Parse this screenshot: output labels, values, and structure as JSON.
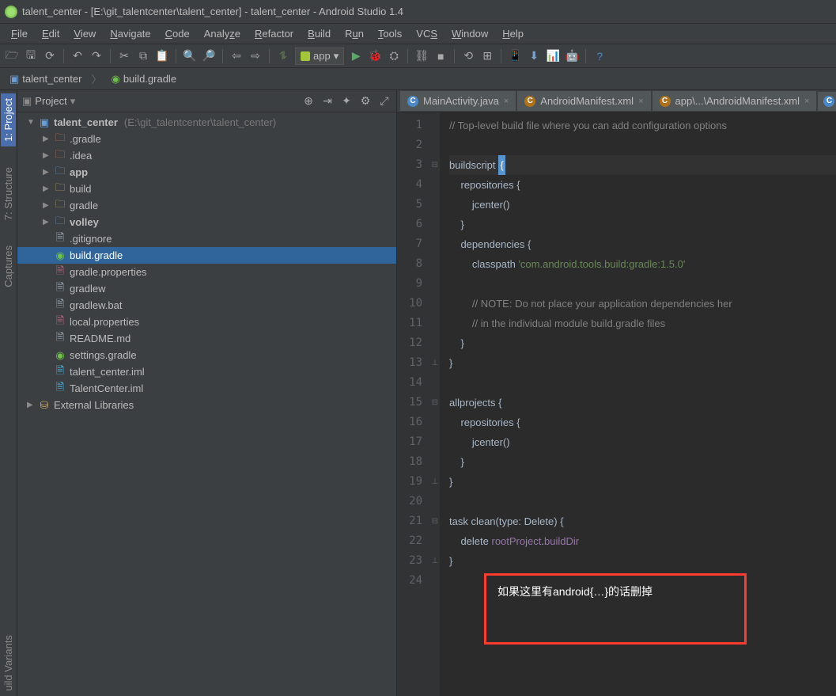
{
  "window": {
    "title": "talent_center - [E:\\git_talentcenter\\talent_center] - talent_center - Android Studio 1.4"
  },
  "menu": {
    "file": "File",
    "edit": "Edit",
    "view": "View",
    "navigate": "Navigate",
    "code": "Code",
    "analyze": "Analyze",
    "refactor": "Refactor",
    "build": "Build",
    "run": "Run",
    "tools": "Tools",
    "vcs": "VCS",
    "window": "Window",
    "help": "Help"
  },
  "run_config": {
    "label": "app",
    "dropdown": "▾"
  },
  "breadcrumb": {
    "project": "talent_center",
    "file": "build.gradle"
  },
  "panel": {
    "title": "Project",
    "dropdown": "▾"
  },
  "side_tabs": {
    "project": "1: Project",
    "structure": "7: Structure",
    "captures": "Captures",
    "build_variants": "uild Variants"
  },
  "tree": {
    "root": {
      "label": "talent_center",
      "hint": "(E:\\git_talentcenter\\talent_center)"
    },
    "items": [
      {
        "label": ".gradle",
        "icon": "folder-red",
        "arrow": "▶",
        "indent": 1
      },
      {
        "label": ".idea",
        "icon": "folder-red",
        "arrow": "▶",
        "indent": 1
      },
      {
        "label": "app",
        "icon": "folder-blue",
        "arrow": "▶",
        "indent": 1,
        "bold": true
      },
      {
        "label": "build",
        "icon": "folder",
        "arrow": "▶",
        "indent": 1
      },
      {
        "label": "gradle",
        "icon": "folder",
        "arrow": "▶",
        "indent": 1
      },
      {
        "label": "volley",
        "icon": "folder-blue",
        "arrow": "▶",
        "indent": 1,
        "bold": true
      },
      {
        "label": ".gitignore",
        "icon": "file",
        "arrow": "",
        "indent": 1
      },
      {
        "label": "build.gradle",
        "icon": "gradle",
        "arrow": "",
        "indent": 1,
        "selected": true
      },
      {
        "label": "gradle.properties",
        "icon": "prop",
        "arrow": "",
        "indent": 1
      },
      {
        "label": "gradlew",
        "icon": "file",
        "arrow": "",
        "indent": 1
      },
      {
        "label": "gradlew.bat",
        "icon": "file",
        "arrow": "",
        "indent": 1
      },
      {
        "label": "local.properties",
        "icon": "prop",
        "arrow": "",
        "indent": 1
      },
      {
        "label": "README.md",
        "icon": "file",
        "arrow": "",
        "indent": 1
      },
      {
        "label": "settings.gradle",
        "icon": "gradle",
        "arrow": "",
        "indent": 1
      },
      {
        "label": "talent_center.iml",
        "icon": "iml",
        "arrow": "",
        "indent": 1
      },
      {
        "label": "TalentCenter.iml",
        "icon": "iml",
        "arrow": "",
        "indent": 1
      }
    ],
    "ext_lib": {
      "label": "External Libraries",
      "arrow": "▶"
    }
  },
  "editor_tabs": [
    {
      "label": "MainActivity.java",
      "icon": "java"
    },
    {
      "label": "AndroidManifest.xml",
      "icon": "xml"
    },
    {
      "label": "app\\...\\AndroidManifest.xml",
      "icon": "xml"
    }
  ],
  "code": {
    "lines": [
      {
        "n": 1,
        "frags": [
          {
            "t": "// Top-level build file where you can add configuration options",
            "cls": "cmt"
          }
        ]
      },
      {
        "n": 2,
        "frags": []
      },
      {
        "n": 3,
        "caret": true,
        "frags": [
          {
            "t": "buildscript ",
            "cls": ""
          },
          {
            "t": "{",
            "caretHere": true
          }
        ]
      },
      {
        "n": 4,
        "frags": [
          {
            "t": "    repositories ",
            "cls": ""
          },
          {
            "t": "{",
            "cls": ""
          }
        ]
      },
      {
        "n": 5,
        "frags": [
          {
            "t": "        jcenter()",
            "cls": ""
          }
        ]
      },
      {
        "n": 6,
        "frags": [
          {
            "t": "    }",
            "cls": ""
          }
        ]
      },
      {
        "n": 7,
        "frags": [
          {
            "t": "    dependencies ",
            "cls": ""
          },
          {
            "t": "{",
            "cls": ""
          }
        ]
      },
      {
        "n": 8,
        "frags": [
          {
            "t": "        classpath ",
            "cls": ""
          },
          {
            "t": "'com.android.tools.build:gradle:1.5.0'",
            "cls": "str"
          }
        ]
      },
      {
        "n": 9,
        "frags": []
      },
      {
        "n": 10,
        "frags": [
          {
            "t": "        // NOTE: Do not place your application dependencies her",
            "cls": "cmt"
          }
        ]
      },
      {
        "n": 11,
        "frags": [
          {
            "t": "        // in the individual module build.gradle files",
            "cls": "cmt"
          }
        ]
      },
      {
        "n": 12,
        "frags": [
          {
            "t": "    }",
            "cls": ""
          }
        ]
      },
      {
        "n": 13,
        "frags": [
          {
            "t": "}",
            "cls": ""
          }
        ]
      },
      {
        "n": 14,
        "frags": []
      },
      {
        "n": 15,
        "frags": [
          {
            "t": "allprojects ",
            "cls": ""
          },
          {
            "t": "{",
            "cls": ""
          }
        ]
      },
      {
        "n": 16,
        "frags": [
          {
            "t": "    repositories ",
            "cls": ""
          },
          {
            "t": "{",
            "cls": ""
          }
        ]
      },
      {
        "n": 17,
        "frags": [
          {
            "t": "        jcenter()",
            "cls": ""
          }
        ]
      },
      {
        "n": 18,
        "frags": [
          {
            "t": "    }",
            "cls": ""
          }
        ]
      },
      {
        "n": 19,
        "frags": [
          {
            "t": "}",
            "cls": ""
          }
        ]
      },
      {
        "n": 20,
        "frags": []
      },
      {
        "n": 21,
        "frags": [
          {
            "t": "task clean(type: Delete) ",
            "cls": ""
          },
          {
            "t": "{",
            "cls": ""
          }
        ]
      },
      {
        "n": 22,
        "frags": [
          {
            "t": "    delete ",
            "cls": ""
          },
          {
            "t": "rootProject",
            "cls": "prop"
          },
          {
            "t": ".",
            "cls": ""
          },
          {
            "t": "buildDir",
            "cls": "prop"
          }
        ]
      },
      {
        "n": 23,
        "frags": [
          {
            "t": "}",
            "cls": ""
          }
        ]
      },
      {
        "n": 24,
        "frags": []
      }
    ],
    "fold": {
      "3": "⊟",
      "4": "",
      "7": "",
      "13": "⊥",
      "15": "⊟",
      "19": "⊥",
      "21": "⊟",
      "23": "⊥"
    }
  },
  "annotation": {
    "text": "如果这里有android{…}的话删掉"
  }
}
